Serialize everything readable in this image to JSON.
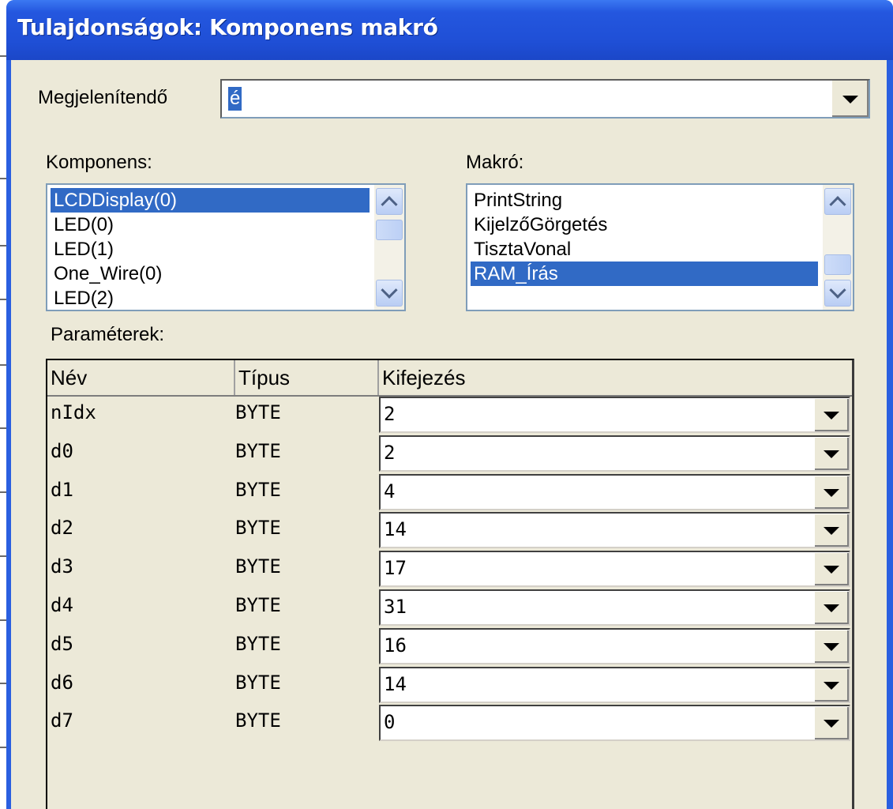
{
  "window": {
    "title": "Tulajdonságok: Komponens makró"
  },
  "display": {
    "label": "Megjelenítendő",
    "value": "é"
  },
  "component": {
    "label": "Komponens:",
    "items": [
      "LCDDisplay(0)",
      "LED(0)",
      "LED(1)",
      "One_Wire(0)",
      "LED(2)"
    ],
    "selected_index": 0
  },
  "macro": {
    "label": "Makró:",
    "items": [
      "PrintString",
      "KijelzőGörgetés",
      "TisztaVonal",
      "RAM_Írás"
    ],
    "selected_index": 3
  },
  "params": {
    "label": "Paraméterek:",
    "headers": {
      "name": "Név",
      "type": "Típus",
      "expr": "Kifejezés"
    },
    "rows": [
      {
        "name": "nIdx",
        "type": "BYTE",
        "expr": "2"
      },
      {
        "name": "d0",
        "type": "BYTE",
        "expr": "2"
      },
      {
        "name": "d1",
        "type": "BYTE",
        "expr": "4"
      },
      {
        "name": "d2",
        "type": "BYTE",
        "expr": "14"
      },
      {
        "name": "d3",
        "type": "BYTE",
        "expr": "17"
      },
      {
        "name": "d4",
        "type": "BYTE",
        "expr": "31"
      },
      {
        "name": "d5",
        "type": "BYTE",
        "expr": "16"
      },
      {
        "name": "d6",
        "type": "BYTE",
        "expr": "14"
      },
      {
        "name": "d7",
        "type": "BYTE",
        "expr": "0"
      }
    ]
  },
  "colors": {
    "title_bar": "#2457df",
    "selection": "#316ac5",
    "dialog_bg": "#ece9d8"
  }
}
